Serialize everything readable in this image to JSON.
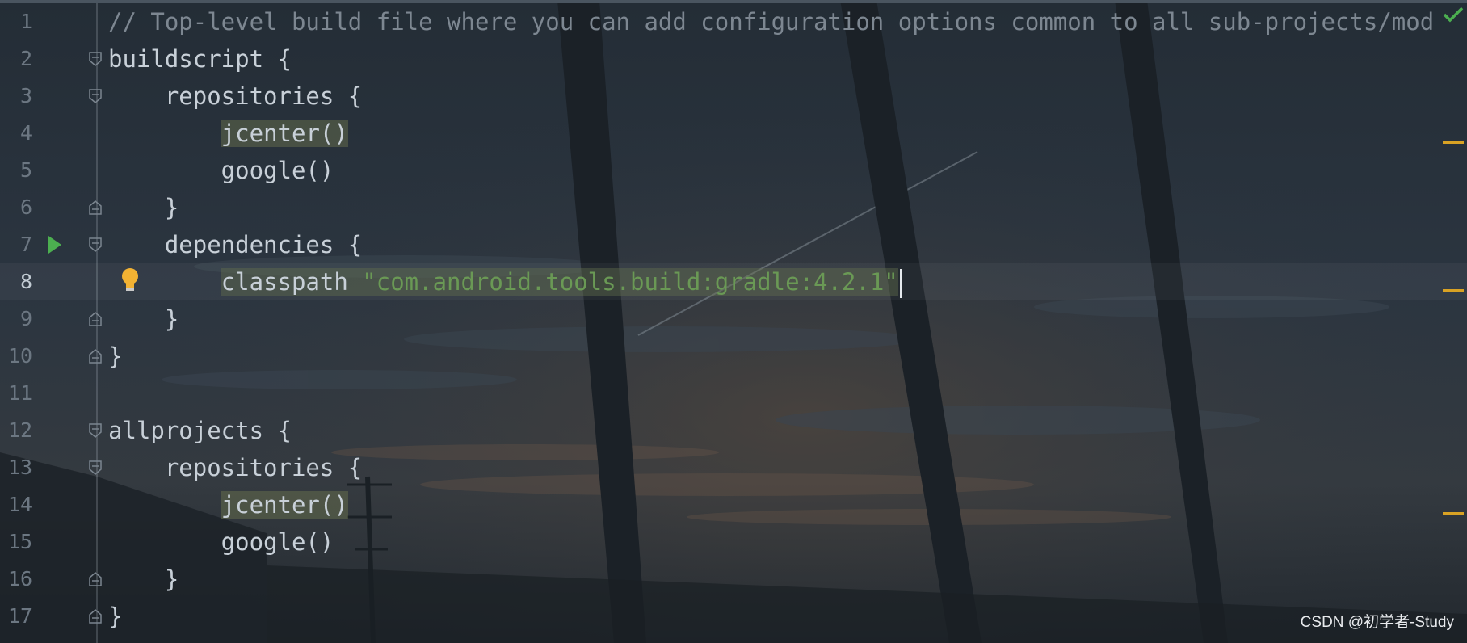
{
  "editor": {
    "lines": [
      {
        "number": "1",
        "text": "// Top-level build file where you can add configuration options common to all sub-projects/mod"
      },
      {
        "number": "2",
        "text": "buildscript {"
      },
      {
        "number": "3",
        "text": "    repositories {"
      },
      {
        "number": "4",
        "indent": "        ",
        "highlight": "jcenter()"
      },
      {
        "number": "5",
        "text": "        google()"
      },
      {
        "number": "6",
        "text": "    }"
      },
      {
        "number": "7",
        "text": "    dependencies {"
      },
      {
        "number": "8",
        "indent": "        ",
        "keyword": "classpath ",
        "string": "\"com.android.tools.build:gradle:4.2.1\""
      },
      {
        "number": "9",
        "text": "    }"
      },
      {
        "number": "10",
        "text": "}"
      },
      {
        "number": "11",
        "text": ""
      },
      {
        "number": "12",
        "text": "allprojects {"
      },
      {
        "number": "13",
        "text": "    repositories {"
      },
      {
        "number": "14",
        "indent": "        ",
        "highlight": "jcenter()"
      },
      {
        "number": "15",
        "text": "        google()"
      },
      {
        "number": "16",
        "text": "    }"
      },
      {
        "number": "17",
        "text": "}"
      }
    ],
    "current_line": "8"
  },
  "icons": {
    "run": "run-gutter-icon",
    "intention": "lightbulb-icon",
    "fold": "fold-marker-icon",
    "inspection_ok": "checkmark-icon"
  },
  "colors": {
    "run": "#4caf50",
    "warning_marker": "#d9a224",
    "string": "#6a9955",
    "comment": "#7d8791",
    "bulb": "#f2b233"
  },
  "watermark": "CSDN @初学者-Study"
}
